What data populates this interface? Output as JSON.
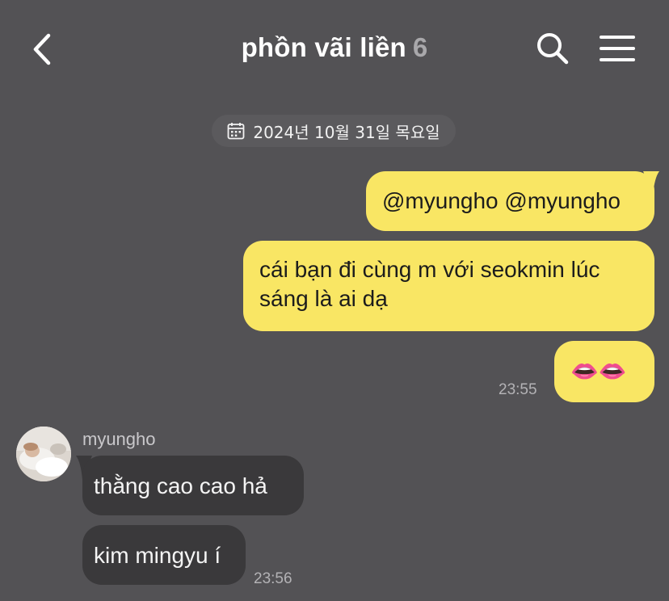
{
  "header": {
    "title": "phồn vãi liền",
    "member_count": "6",
    "back_icon": "chevron-left-icon",
    "search_icon": "search-icon",
    "menu_icon": "hamburger-menu-icon"
  },
  "date_separator": {
    "icon": "calendar-icon",
    "text": "2024년 10월 31일 목요일"
  },
  "messages_out": [
    {
      "text": "@myungho @myungho"
    },
    {
      "text": "cái bạn đi cùng m với seokmin lúc sáng là ai dạ"
    },
    {
      "text": "👄👄"
    }
  ],
  "messages_out_time": "23:55",
  "incoming": {
    "sender": "myungho",
    "messages": [
      {
        "text": "thằng cao cao hả"
      },
      {
        "text": "kim mingyu í"
      }
    ],
    "time": "23:56"
  },
  "colors": {
    "background": "#535255",
    "outgoing_bubble": "#f9e664",
    "incoming_bubble": "#3a393b",
    "timestamp": "#b3b2b5"
  }
}
